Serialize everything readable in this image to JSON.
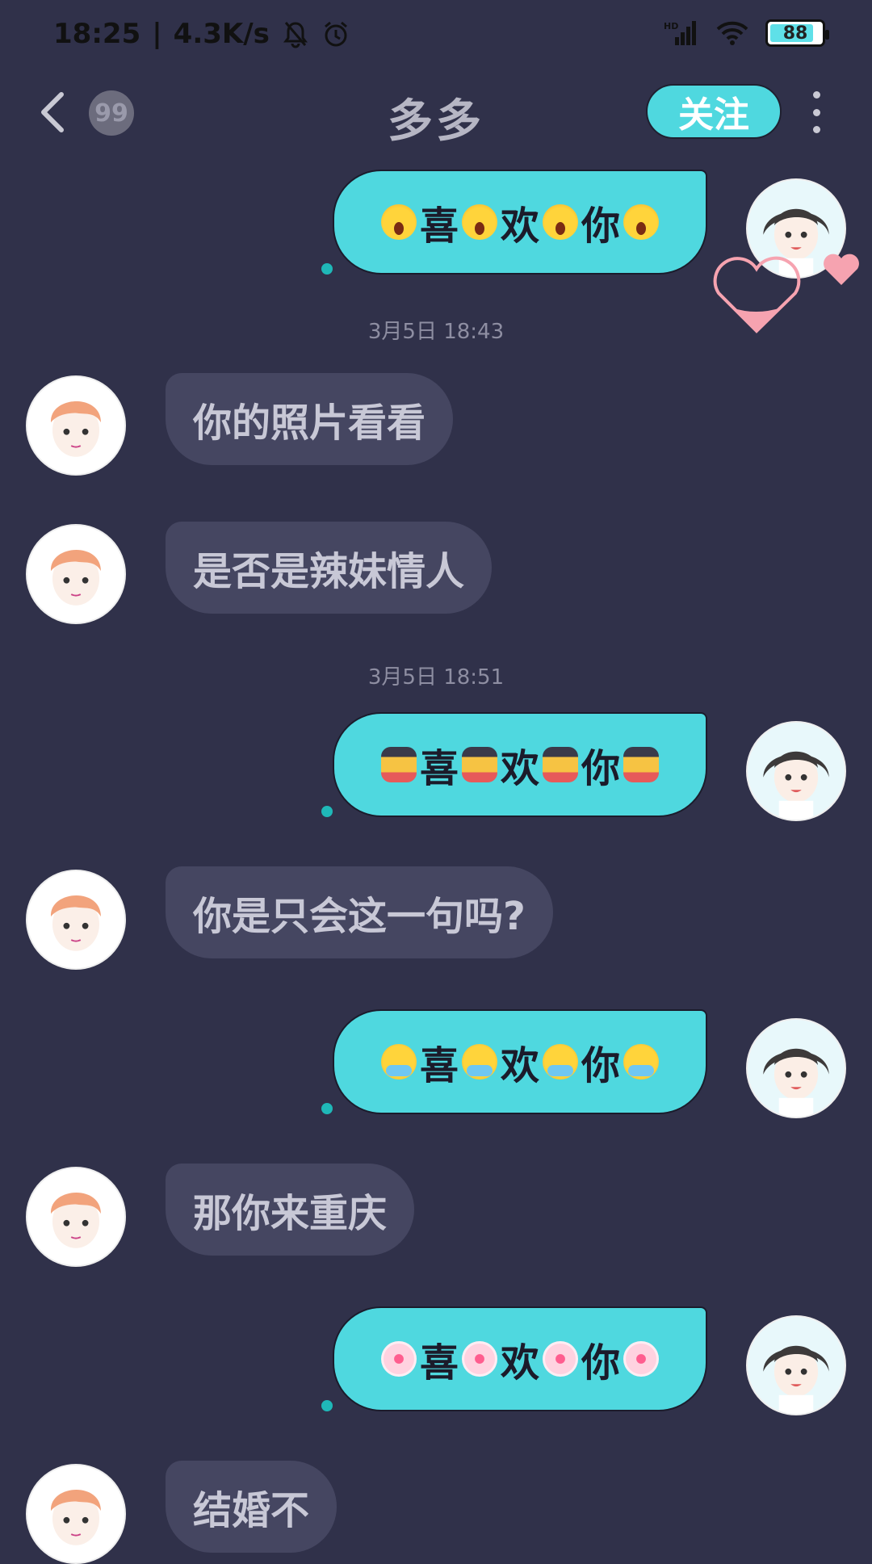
{
  "status_bar": {
    "time": "18:25",
    "separator": "|",
    "net_speed": "4.3K/s",
    "signal_label": "HD",
    "battery": "88"
  },
  "header": {
    "unread_count": "99",
    "title": "多多",
    "follow_label": "关注"
  },
  "messages": [
    {
      "side": "out",
      "text": [
        "喜",
        "欢",
        "你"
      ],
      "emoji": "scream-face"
    },
    {
      "type": "time",
      "text": "3月5日 18:43"
    },
    {
      "side": "in",
      "text": "你的照片看看"
    },
    {
      "side": "in",
      "text": "是否是辣妹情人"
    },
    {
      "type": "time",
      "text": "3月5日 18:51"
    },
    {
      "side": "out",
      "text": [
        "喜",
        "欢",
        "你"
      ],
      "emoji": "bear-doll"
    },
    {
      "side": "in",
      "text": "你是只会这一句吗?"
    },
    {
      "side": "out",
      "text": [
        "喜",
        "欢",
        "你"
      ],
      "emoji": "crying-face"
    },
    {
      "side": "in",
      "text": "那你来重庆"
    },
    {
      "side": "out",
      "text": [
        "喜",
        "欢",
        "你"
      ],
      "emoji": "cherry-blossom"
    },
    {
      "side": "in",
      "text": "结婚不"
    }
  ],
  "colors": {
    "background": "#30314a",
    "outgoing_bubble": "#4fd8df",
    "incoming_bubble": "#454661",
    "follow_button": "#4fd8df"
  }
}
